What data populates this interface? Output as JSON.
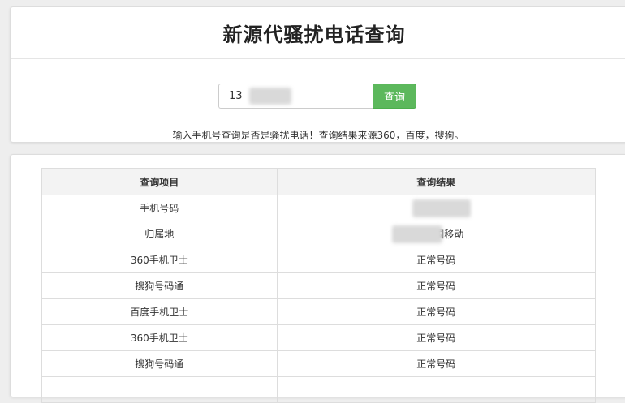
{
  "header": {
    "title": "新源代骚扰电话查询"
  },
  "search": {
    "input_value": "13",
    "button_label": "查询",
    "hint": "输入手机号查询是否是骚扰电话！查询结果来源360，百度，搜狗。"
  },
  "results": {
    "columns": [
      "查询项目",
      "查询结果"
    ],
    "rows": [
      {
        "item": "手机号码",
        "result": ""
      },
      {
        "item": "归属地",
        "result": "中国移动"
      },
      {
        "item": "360手机卫士",
        "result": "正常号码"
      },
      {
        "item": "搜狗号码通",
        "result": "正常号码"
      },
      {
        "item": "百度手机卫士",
        "result": "正常号码"
      },
      {
        "item": "360手机卫士",
        "result": "正常号码"
      },
      {
        "item": "搜狗号码通",
        "result": "正常号码"
      },
      {
        "item": "",
        "result": ""
      }
    ]
  },
  "colors": {
    "accent_green": "#5cb85c",
    "page_background": "#eeeeee",
    "table_header_background": "#f3f3f3"
  }
}
